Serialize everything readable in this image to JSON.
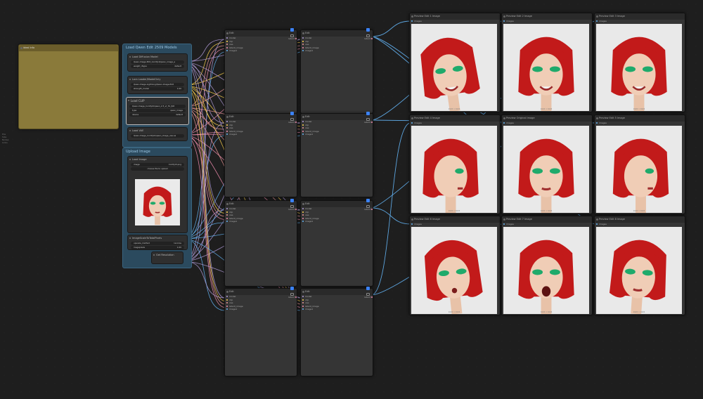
{
  "note": {
    "title": "ideal info"
  },
  "side_text": [
    "Pos",
    "Size",
    "Nodes",
    "Links"
  ],
  "groups": {
    "load": {
      "title": "Load Qwen Edit 2509 Models",
      "nodes": [
        {
          "title": "Load Diffusion Model",
          "widgets": [
            {
              "label": "Qwen-Image-Edit_ComfyUI/qwen_image_e",
              "value": ""
            },
            {
              "label": "weight_dtype",
              "value": "default"
            }
          ]
        },
        {
          "title": "Lora Loader/ModelOnly",
          "widgets": [
            {
              "label": "Qwen-Image-Lightning/Qwen-Image-Edit",
              "value": ""
            },
            {
              "label": "strength_model",
              "value": "1.00"
            }
          ]
        },
        {
          "title": "Load CLIP",
          "widgets": [
            {
              "label": "Qwen-Image_ComfyUI/qwen_2.5_vl_7b_fp8",
              "value": ""
            },
            {
              "label": "type",
              "value": "qwen_image"
            },
            {
              "label": "device",
              "value": "default"
            }
          ]
        },
        {
          "title": "Load VAE",
          "widgets": [
            {
              "label": "Qwen-Image_ComfyUI/qwen_image_vae.sa",
              "value": ""
            }
          ]
        }
      ]
    },
    "upload": {
      "title": "Upload Image",
      "nodes": [
        {
          "title": "Load Image",
          "widgets": [
            {
              "label": "image",
              "value": "ComfyUI.png"
            },
            {
              "label": "choose file to upload",
              "value": ""
            }
          ]
        },
        {
          "title": "ImageScaleToTotalPixels",
          "widgets": [
            {
              "label": "upscale_method",
              "value": "lanczos"
            },
            {
              "label": "megapixels",
              "value": "1.00"
            }
          ]
        },
        {
          "title": "Get Resolution",
          "widgets": []
        }
      ]
    }
  },
  "edit_nodes": {
    "title": "Edit",
    "inputs": [
      "model",
      "clip",
      "vae",
      "latent_image",
      "image1"
    ],
    "output": "latent"
  },
  "previews": [
    {
      "title": "Preview Edit 1 Image",
      "input": "images",
      "footer": "1024 × 1024"
    },
    {
      "title": "Preview Edit 2 Image",
      "input": "images",
      "footer": "1024 × 1024"
    },
    {
      "title": "Preview Edit 3 Image",
      "input": "images",
      "footer": "1024 × 1024"
    },
    {
      "title": "Preview Edit 4 Image",
      "input": "images",
      "footer": "1024 × 1024"
    },
    {
      "title": "Preview Original Image",
      "input": "images",
      "footer": "1024 × 1024"
    },
    {
      "title": "Preview Edit 5 Image",
      "input": "images",
      "footer": "1024 × 1024"
    },
    {
      "title": "Preview Edit 6 Image",
      "input": "images",
      "footer": "1024 × 1024"
    },
    {
      "title": "Preview Edit 7 Image",
      "input": "images",
      "footer": "1024 × 1024"
    },
    {
      "title": "Preview Edit 8 Image",
      "input": "images",
      "footer": "1024 × 1024"
    }
  ],
  "colors": {
    "canvas": "#1e1e1e",
    "node": "#353535",
    "group": "#2b4a5e",
    "note": "#8a7a3a",
    "wire_model": "#b39ddb",
    "wire_clip": "#ffd54f",
    "wire_vae": "#ef9a9a",
    "wire_image": "#64b5f6",
    "wire_latent": "#f48fb1",
    "hair": "#c21a1a",
    "eyeshadow": "#1faa6b"
  }
}
